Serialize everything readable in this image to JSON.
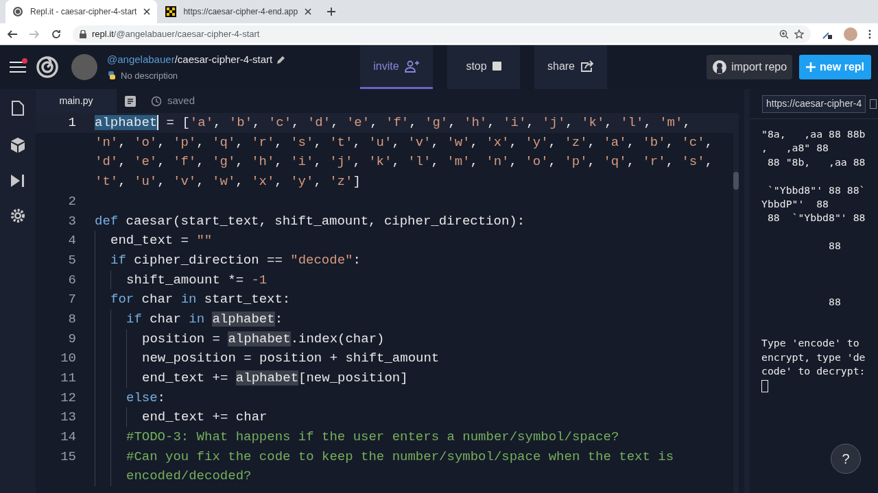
{
  "browser": {
    "tabs": [
      {
        "title": "Repl.it - caesar-cipher-4-start",
        "selected": true,
        "kind": "repl"
      },
      {
        "title": "https://caesar-cipher-4-end.app",
        "selected": false,
        "kind": "site"
      }
    ],
    "address": {
      "host": "repl.it",
      "path": "/@angelabauer/caesar-cipher-4-start"
    }
  },
  "header": {
    "notification": true,
    "owner": "@angelabauer",
    "separator": "/",
    "repl_name": "caesar-cipher-4-start",
    "description": "No description",
    "tabs": [
      {
        "label": "invite",
        "selected": true,
        "kind": "invite"
      },
      {
        "label": "stop",
        "selected": false,
        "kind": "stop"
      },
      {
        "label": "share",
        "selected": false,
        "kind": "share"
      }
    ],
    "import_button": "import repo",
    "new_button": "new repl"
  },
  "editor": {
    "file_tab": {
      "label": "main.py",
      "selected": true
    },
    "status": "saved",
    "lines": [
      {
        "number": "1",
        "current": true,
        "rows": [
          {
            "tokens": [
              {
                "kind": "sel",
                "text": "alphabet"
              },
              {
                "kind": "p",
                "text": " = ["
              },
              {
                "kind": "s",
                "text": "'a'"
              },
              {
                "kind": "p",
                "text": ", "
              },
              {
                "kind": "s",
                "text": "'b'"
              },
              {
                "kind": "p",
                "text": ", "
              },
              {
                "kind": "s",
                "text": "'c'"
              },
              {
                "kind": "p",
                "text": ", "
              },
              {
                "kind": "s",
                "text": "'d'"
              },
              {
                "kind": "p",
                "text": ", "
              },
              {
                "kind": "s",
                "text": "'e'"
              },
              {
                "kind": "p",
                "text": ", "
              },
              {
                "kind": "s",
                "text": "'f'"
              },
              {
                "kind": "p",
                "text": ", "
              },
              {
                "kind": "s",
                "text": "'g'"
              },
              {
                "kind": "p",
                "text": ", "
              },
              {
                "kind": "s",
                "text": "'h'"
              },
              {
                "kind": "p",
                "text": ", "
              },
              {
                "kind": "s",
                "text": "'i'"
              },
              {
                "kind": "p",
                "text": ", "
              },
              {
                "kind": "s",
                "text": "'j'"
              },
              {
                "kind": "p",
                "text": ", "
              },
              {
                "kind": "s",
                "text": "'k'"
              },
              {
                "kind": "p",
                "text": ", "
              },
              {
                "kind": "s",
                "text": "'l'"
              },
              {
                "kind": "p",
                "text": ", "
              },
              {
                "kind": "s",
                "text": "'m'"
              },
              {
                "kind": "p",
                "text": ","
              }
            ]
          },
          {
            "tokens": [
              {
                "kind": "s",
                "text": "'n'"
              },
              {
                "kind": "p",
                "text": ", "
              },
              {
                "kind": "s",
                "text": "'o'"
              },
              {
                "kind": "p",
                "text": ", "
              },
              {
                "kind": "s",
                "text": "'p'"
              },
              {
                "kind": "p",
                "text": ", "
              },
              {
                "kind": "s",
                "text": "'q'"
              },
              {
                "kind": "p",
                "text": ", "
              },
              {
                "kind": "s",
                "text": "'r'"
              },
              {
                "kind": "p",
                "text": ", "
              },
              {
                "kind": "s",
                "text": "'s'"
              },
              {
                "kind": "p",
                "text": ", "
              },
              {
                "kind": "s",
                "text": "'t'"
              },
              {
                "kind": "p",
                "text": ", "
              },
              {
                "kind": "s",
                "text": "'u'"
              },
              {
                "kind": "p",
                "text": ", "
              },
              {
                "kind": "s",
                "text": "'v'"
              },
              {
                "kind": "p",
                "text": ", "
              },
              {
                "kind": "s",
                "text": "'w'"
              },
              {
                "kind": "p",
                "text": ", "
              },
              {
                "kind": "s",
                "text": "'x'"
              },
              {
                "kind": "p",
                "text": ", "
              },
              {
                "kind": "s",
                "text": "'y'"
              },
              {
                "kind": "p",
                "text": ", "
              },
              {
                "kind": "s",
                "text": "'z'"
              },
              {
                "kind": "p",
                "text": ", "
              },
              {
                "kind": "s",
                "text": "'a'"
              },
              {
                "kind": "p",
                "text": ", "
              },
              {
                "kind": "s",
                "text": "'b'"
              },
              {
                "kind": "p",
                "text": ", "
              },
              {
                "kind": "s",
                "text": "'c'"
              },
              {
                "kind": "p",
                "text": ","
              }
            ]
          },
          {
            "tokens": [
              {
                "kind": "s",
                "text": "'d'"
              },
              {
                "kind": "p",
                "text": ", "
              },
              {
                "kind": "s",
                "text": "'e'"
              },
              {
                "kind": "p",
                "text": ", "
              },
              {
                "kind": "s",
                "text": "'f'"
              },
              {
                "kind": "p",
                "text": ", "
              },
              {
                "kind": "s",
                "text": "'g'"
              },
              {
                "kind": "p",
                "text": ", "
              },
              {
                "kind": "s",
                "text": "'h'"
              },
              {
                "kind": "p",
                "text": ", "
              },
              {
                "kind": "s",
                "text": "'i'"
              },
              {
                "kind": "p",
                "text": ", "
              },
              {
                "kind": "s",
                "text": "'j'"
              },
              {
                "kind": "p",
                "text": ", "
              },
              {
                "kind": "s",
                "text": "'k'"
              },
              {
                "kind": "p",
                "text": ", "
              },
              {
                "kind": "s",
                "text": "'l'"
              },
              {
                "kind": "p",
                "text": ", "
              },
              {
                "kind": "s",
                "text": "'m'"
              },
              {
                "kind": "p",
                "text": ", "
              },
              {
                "kind": "s",
                "text": "'n'"
              },
              {
                "kind": "p",
                "text": ", "
              },
              {
                "kind": "s",
                "text": "'o'"
              },
              {
                "kind": "p",
                "text": ", "
              },
              {
                "kind": "s",
                "text": "'p'"
              },
              {
                "kind": "p",
                "text": ", "
              },
              {
                "kind": "s",
                "text": "'q'"
              },
              {
                "kind": "p",
                "text": ", "
              },
              {
                "kind": "s",
                "text": "'r'"
              },
              {
                "kind": "p",
                "text": ", "
              },
              {
                "kind": "s",
                "text": "'s'"
              },
              {
                "kind": "p",
                "text": ","
              }
            ]
          },
          {
            "tokens": [
              {
                "kind": "s",
                "text": "'t'"
              },
              {
                "kind": "p",
                "text": ", "
              },
              {
                "kind": "s",
                "text": "'u'"
              },
              {
                "kind": "p",
                "text": ", "
              },
              {
                "kind": "s",
                "text": "'v'"
              },
              {
                "kind": "p",
                "text": ", "
              },
              {
                "kind": "s",
                "text": "'w'"
              },
              {
                "kind": "p",
                "text": ", "
              },
              {
                "kind": "s",
                "text": "'x'"
              },
              {
                "kind": "p",
                "text": ", "
              },
              {
                "kind": "s",
                "text": "'y'"
              },
              {
                "kind": "p",
                "text": ", "
              },
              {
                "kind": "s",
                "text": "'z'"
              },
              {
                "kind": "p",
                "text": "]"
              }
            ]
          }
        ]
      },
      {
        "number": "2",
        "current": false
      },
      {
        "number": "3",
        "current": false,
        "rows": [
          {
            "tokens": [
              {
                "kind": "k",
                "text": "def"
              },
              {
                "kind": "p",
                "text": " caesar(start_text, shift_amount, cipher_direction):"
              }
            ]
          }
        ]
      },
      {
        "number": "4",
        "current": false,
        "rows": [
          {
            "tokens": [
              {
                "kind": "indent"
              },
              {
                "kind": "p",
                "text": "end_text = "
              },
              {
                "kind": "s",
                "text": "\"\""
              }
            ]
          }
        ]
      },
      {
        "number": "5",
        "current": false,
        "rows": [
          {
            "tokens": [
              {
                "kind": "indent"
              },
              {
                "kind": "k",
                "text": "if"
              },
              {
                "kind": "p",
                "text": " cipher_direction == "
              },
              {
                "kind": "s",
                "text": "\"decode\""
              },
              {
                "kind": "p",
                "text": ":"
              }
            ]
          }
        ]
      },
      {
        "number": "6",
        "current": false,
        "rows": [
          {
            "tokens": [
              {
                "kind": "indent"
              },
              {
                "kind": "indent"
              },
              {
                "kind": "p",
                "text": "shift_amount *= "
              },
              {
                "kind": "n",
                "text": "-1"
              }
            ]
          }
        ]
      },
      {
        "number": "7",
        "current": false,
        "rows": [
          {
            "tokens": [
              {
                "kind": "indent"
              },
              {
                "kind": "k",
                "text": "for"
              },
              {
                "kind": "p",
                "text": " char "
              },
              {
                "kind": "k",
                "text": "in"
              },
              {
                "kind": "p",
                "text": " start_text:"
              }
            ]
          }
        ]
      },
      {
        "number": "8",
        "current": false,
        "rows": [
          {
            "tokens": [
              {
                "kind": "indent"
              },
              {
                "kind": "indent"
              },
              {
                "kind": "k",
                "text": "if"
              },
              {
                "kind": "p",
                "text": " char "
              },
              {
                "kind": "k",
                "text": "in "
              },
              {
                "kind": "h",
                "text": "alphabet"
              },
              {
                "kind": "p",
                "text": ":"
              }
            ]
          }
        ]
      },
      {
        "number": "9",
        "current": false,
        "rows": [
          {
            "tokens": [
              {
                "kind": "indent"
              },
              {
                "kind": "indent"
              },
              {
                "kind": "indent"
              },
              {
                "kind": "p",
                "text": "position = "
              },
              {
                "kind": "h",
                "text": "alphabet"
              },
              {
                "kind": "p",
                "text": ".index(char)"
              }
            ]
          }
        ]
      },
      {
        "number": "10",
        "current": false,
        "rows": [
          {
            "tokens": [
              {
                "kind": "indent"
              },
              {
                "kind": "indent"
              },
              {
                "kind": "indent"
              },
              {
                "kind": "p",
                "text": "new_position = position + shift_amount"
              }
            ]
          }
        ]
      },
      {
        "number": "11",
        "current": false,
        "rows": [
          {
            "tokens": [
              {
                "kind": "indent"
              },
              {
                "kind": "indent"
              },
              {
                "kind": "indent"
              },
              {
                "kind": "p",
                "text": "end_text += "
              },
              {
                "kind": "h",
                "text": "alphabet"
              },
              {
                "kind": "p",
                "text": "[new_position]"
              }
            ]
          }
        ]
      },
      {
        "number": "12",
        "current": false,
        "rows": [
          {
            "tokens": [
              {
                "kind": "indent"
              },
              {
                "kind": "indent"
              },
              {
                "kind": "k",
                "text": "else"
              },
              {
                "kind": "p",
                "text": ":"
              }
            ]
          }
        ]
      },
      {
        "number": "13",
        "current": false,
        "rows": [
          {
            "tokens": [
              {
                "kind": "indent"
              },
              {
                "kind": "indent"
              },
              {
                "kind": "indent"
              },
              {
                "kind": "p",
                "text": "end_text += char"
              }
            ]
          }
        ]
      },
      {
        "number": "14",
        "current": false,
        "rows": [
          {
            "tokens": [
              {
                "kind": "indent"
              },
              {
                "kind": "indent"
              },
              {
                "kind": "c",
                "text": "#TODO-3: What happens if the user enters a number/symbol/space?"
              }
            ]
          }
        ]
      },
      {
        "number": "15",
        "current": false,
        "rows": [
          {
            "tokens": [
              {
                "kind": "indent"
              },
              {
                "kind": "indent"
              },
              {
                "kind": "c",
                "text": "#Can you fix the code to keep the number/symbol/space when the text is"
              }
            ]
          },
          {
            "tokens": [
              {
                "kind": "indent"
              },
              {
                "kind": "indent"
              },
              {
                "kind": "c",
                "text": "encoded/decoded?"
              }
            ]
          }
        ]
      }
    ]
  },
  "console": {
    "url": "https://caesar-cipher-4",
    "art": "\"8a,   ,aa 88 88b\n,   ,a8\" 88\n 88 \"8b,   ,aa 88\n\n `\"Ybbd8\"' 88 88`\nYbbdP\"'  88\n 88  `\"Ybbd8\"' 88\n\n           88\n\n\n\n           88",
    "prompt": "Type 'encode' to encrypt, type 'decode' to decrypt:"
  },
  "help_button": "?"
}
